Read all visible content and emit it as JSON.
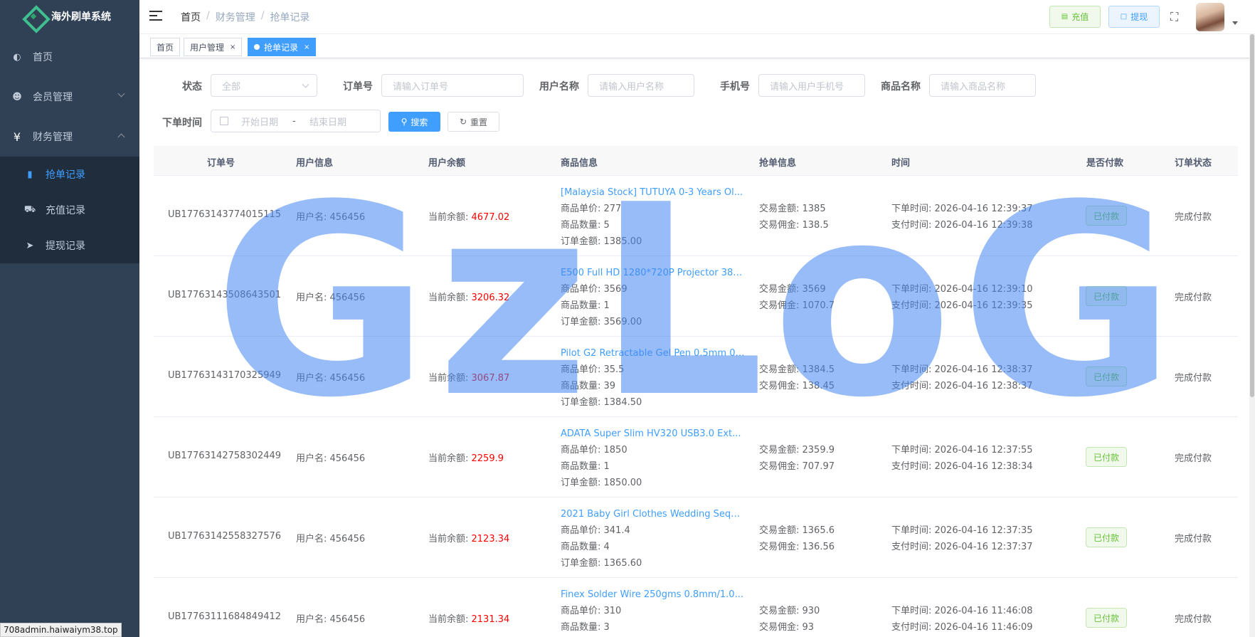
{
  "app": {
    "title": "海外刷单系统"
  },
  "sidebar": {
    "items": [
      {
        "label": "首页",
        "icon": "dashboard-icon"
      },
      {
        "label": "会员管理",
        "icon": "users-icon"
      },
      {
        "label": "财务管理",
        "icon": "yen-icon"
      }
    ],
    "submenu": [
      {
        "label": "抢单记录",
        "icon": "document-icon",
        "active": true
      },
      {
        "label": "充值记录",
        "icon": "cart-icon"
      },
      {
        "label": "提现记录",
        "icon": "send-icon"
      }
    ]
  },
  "navbar": {
    "breadcrumb": [
      "首页",
      "财务管理",
      "抢单记录"
    ],
    "separator": "/",
    "recharge_label": "充值",
    "withdraw_label": "提现"
  },
  "tags": [
    {
      "label": "首页"
    },
    {
      "label": "用户管理",
      "close": "×"
    },
    {
      "label": "抢单记录",
      "close": "×",
      "active": true
    }
  ],
  "filters": {
    "status_label": "状态",
    "status_value": "全部",
    "order_label": "订单号",
    "order_placeholder": "请输入订单号",
    "username_label": "用户名称",
    "username_placeholder": "请输入用户名称",
    "phone_label": "手机号",
    "phone_placeholder": "请输入用户手机号",
    "product_label": "商品名称",
    "product_placeholder": "请输入商品名称",
    "time_label": "下单时间",
    "start_placeholder": "开始日期",
    "range_sep": "-",
    "end_placeholder": "结束日期",
    "search_label": "搜索",
    "reset_label": "重置"
  },
  "table": {
    "headers": [
      "订单号",
      "用户信息",
      "用户余额",
      "商品信息",
      "抢单信息",
      "时间",
      "是否付款",
      "订单状态"
    ],
    "rows": [
      {
        "order_no": "UB17763143774015115",
        "user": "用户名: 456456",
        "balance_label": "当前余额: ",
        "balance": "4677.02",
        "product_title": "[Malaysia Stock] TUTUYA 0-3 Years Ol...",
        "unit_price": "商品单价: 277",
        "quantity": "商品数量: 5",
        "order_amount": "订单金额: 1385.00",
        "trade_amount": "交易金额: 1385",
        "commission": "交易佣金: 138.5",
        "order_time": "下单时间: 2026-04-16 12:39:37",
        "pay_time": "支付时间: 2026-04-16 12:39:38",
        "paid": "已付款",
        "status": "完成付款"
      },
      {
        "order_no": "UB17763143508643501",
        "user": "用户名: 456456",
        "balance_label": "当前余额: ",
        "balance": "3206.32",
        "product_title": "E500 Full HD 1280*720P Projector 380...",
        "unit_price": "商品单价: 3569",
        "quantity": "商品数量: 1",
        "order_amount": "订单金额: 3569.00",
        "trade_amount": "交易金额: 3569",
        "commission": "交易佣金: 1070.7",
        "order_time": "下单时间: 2026-04-16 12:39:10",
        "pay_time": "支付时间: 2026-04-16 12:39:35",
        "paid": "已付款",
        "status": "完成付款"
      },
      {
        "order_no": "UB17763143170325949",
        "user": "用户名: 456456",
        "balance_label": "当前余额: ",
        "balance": "3067.87",
        "product_title": "Pilot G2 Retractable Gel Pen 0.5mm 0....",
        "unit_price": "商品单价: 35.5",
        "quantity": "商品数量: 39",
        "order_amount": "订单金额: 1384.50",
        "trade_amount": "交易金额: 1384.5",
        "commission": "交易佣金: 138.45",
        "order_time": "下单时间: 2026-04-16 12:38:37",
        "pay_time": "支付时间: 2026-04-16 12:38:37",
        "paid": "已付款",
        "status": "完成付款"
      },
      {
        "order_no": "UB17763142758302449",
        "user": "用户名: 456456",
        "balance_label": "当前余额: ",
        "balance": "2259.9",
        "product_title": "ADATA Super Slim HV320 USB3.0 Ext...",
        "unit_price": "商品单价: 1850",
        "quantity": "商品数量: 1",
        "order_amount": "订单金额: 1850.00",
        "trade_amount": "交易金额: 2359.9",
        "commission": "交易佣金: 707.97",
        "order_time": "下单时间: 2026-04-16 12:37:55",
        "pay_time": "支付时间: 2026-04-16 12:38:34",
        "paid": "已付款",
        "status": "完成付款"
      },
      {
        "order_no": "UB17763142558327576",
        "user": "用户名: 456456",
        "balance_label": "当前余额: ",
        "balance": "2123.34",
        "product_title": "2021 Baby Girl Clothes Wedding Sequi...",
        "unit_price": "商品单价: 341.4",
        "quantity": "商品数量: 4",
        "order_amount": "订单金额: 1365.60",
        "trade_amount": "交易金额: 1365.6",
        "commission": "交易佣金: 136.56",
        "order_time": "下单时间: 2026-04-16 12:37:35",
        "pay_time": "支付时间: 2026-04-16 12:37:37",
        "paid": "已付款",
        "status": "完成付款"
      },
      {
        "order_no": "UB17763111684849412",
        "user": "用户名: 456456",
        "balance_label": "当前余额: ",
        "balance": "2131.34",
        "product_title": "Finex Solder Wire 250gms 0.8mm/1.0...",
        "unit_price": "商品单价: 310",
        "quantity": "商品数量: 3",
        "order_amount": "",
        "trade_amount": "交易金额: 930",
        "commission": "交易佣金: 93",
        "order_time": "下单时间: 2026-04-16 11:46:08",
        "pay_time": "支付时间: 2026-04-16 11:46:09",
        "paid": "已付款",
        "status": "完成付款"
      }
    ]
  },
  "watermark": "GzLoG",
  "status_url": "708admin.haiwaiym38.top",
  "colors": {
    "sidebar": "#304156",
    "submenu": "#1f2d3d",
    "accent": "#409eff",
    "success": "#67c23a",
    "danger": "#ff0000"
  }
}
